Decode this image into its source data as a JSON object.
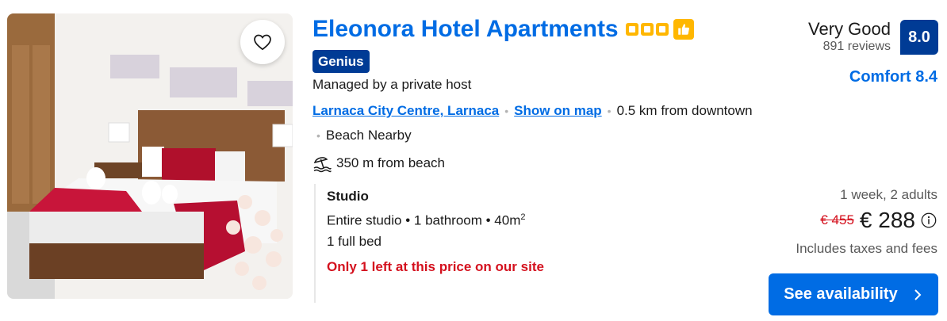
{
  "hotel": {
    "name": "Eleonora Hotel Apartments",
    "star_count": 3,
    "genius_label": "Genius",
    "managed_by": "Managed by a private host",
    "location_link": "Larnaca City Centre, Larnaca",
    "map_link": "Show on map",
    "distance_downtown": "0.5 km from downtown",
    "beach_nearby": "Beach Nearby",
    "beach_distance": "350 m from beach"
  },
  "review": {
    "word": "Very Good",
    "count": "891 reviews",
    "score": "8.0",
    "comfort": "Comfort 8.4"
  },
  "room": {
    "name": "Studio",
    "desc_main": "Entire studio • 1 bathroom • 40m",
    "desc_sup": "2",
    "beds": "1 full bed",
    "scarcity": "Only 1 left at this price on our site"
  },
  "pricing": {
    "stay": "1 week, 2 adults",
    "old_price": "€ 455",
    "new_price": "€ 288",
    "taxes": "Includes taxes and fees"
  },
  "actions": {
    "availability_label": "See availability"
  },
  "icons": {
    "favorite": "heart-outline-icon",
    "thumb": "thumbs-up-icon",
    "beach": "beach-umbrella-icon",
    "info": "info-circle-icon",
    "chevron": "chevron-right-icon"
  },
  "colors": {
    "link_blue": "#006ce4",
    "brand_dark": "#003b95",
    "star_yellow": "#ffb700",
    "alert_red": "#d4111e"
  }
}
